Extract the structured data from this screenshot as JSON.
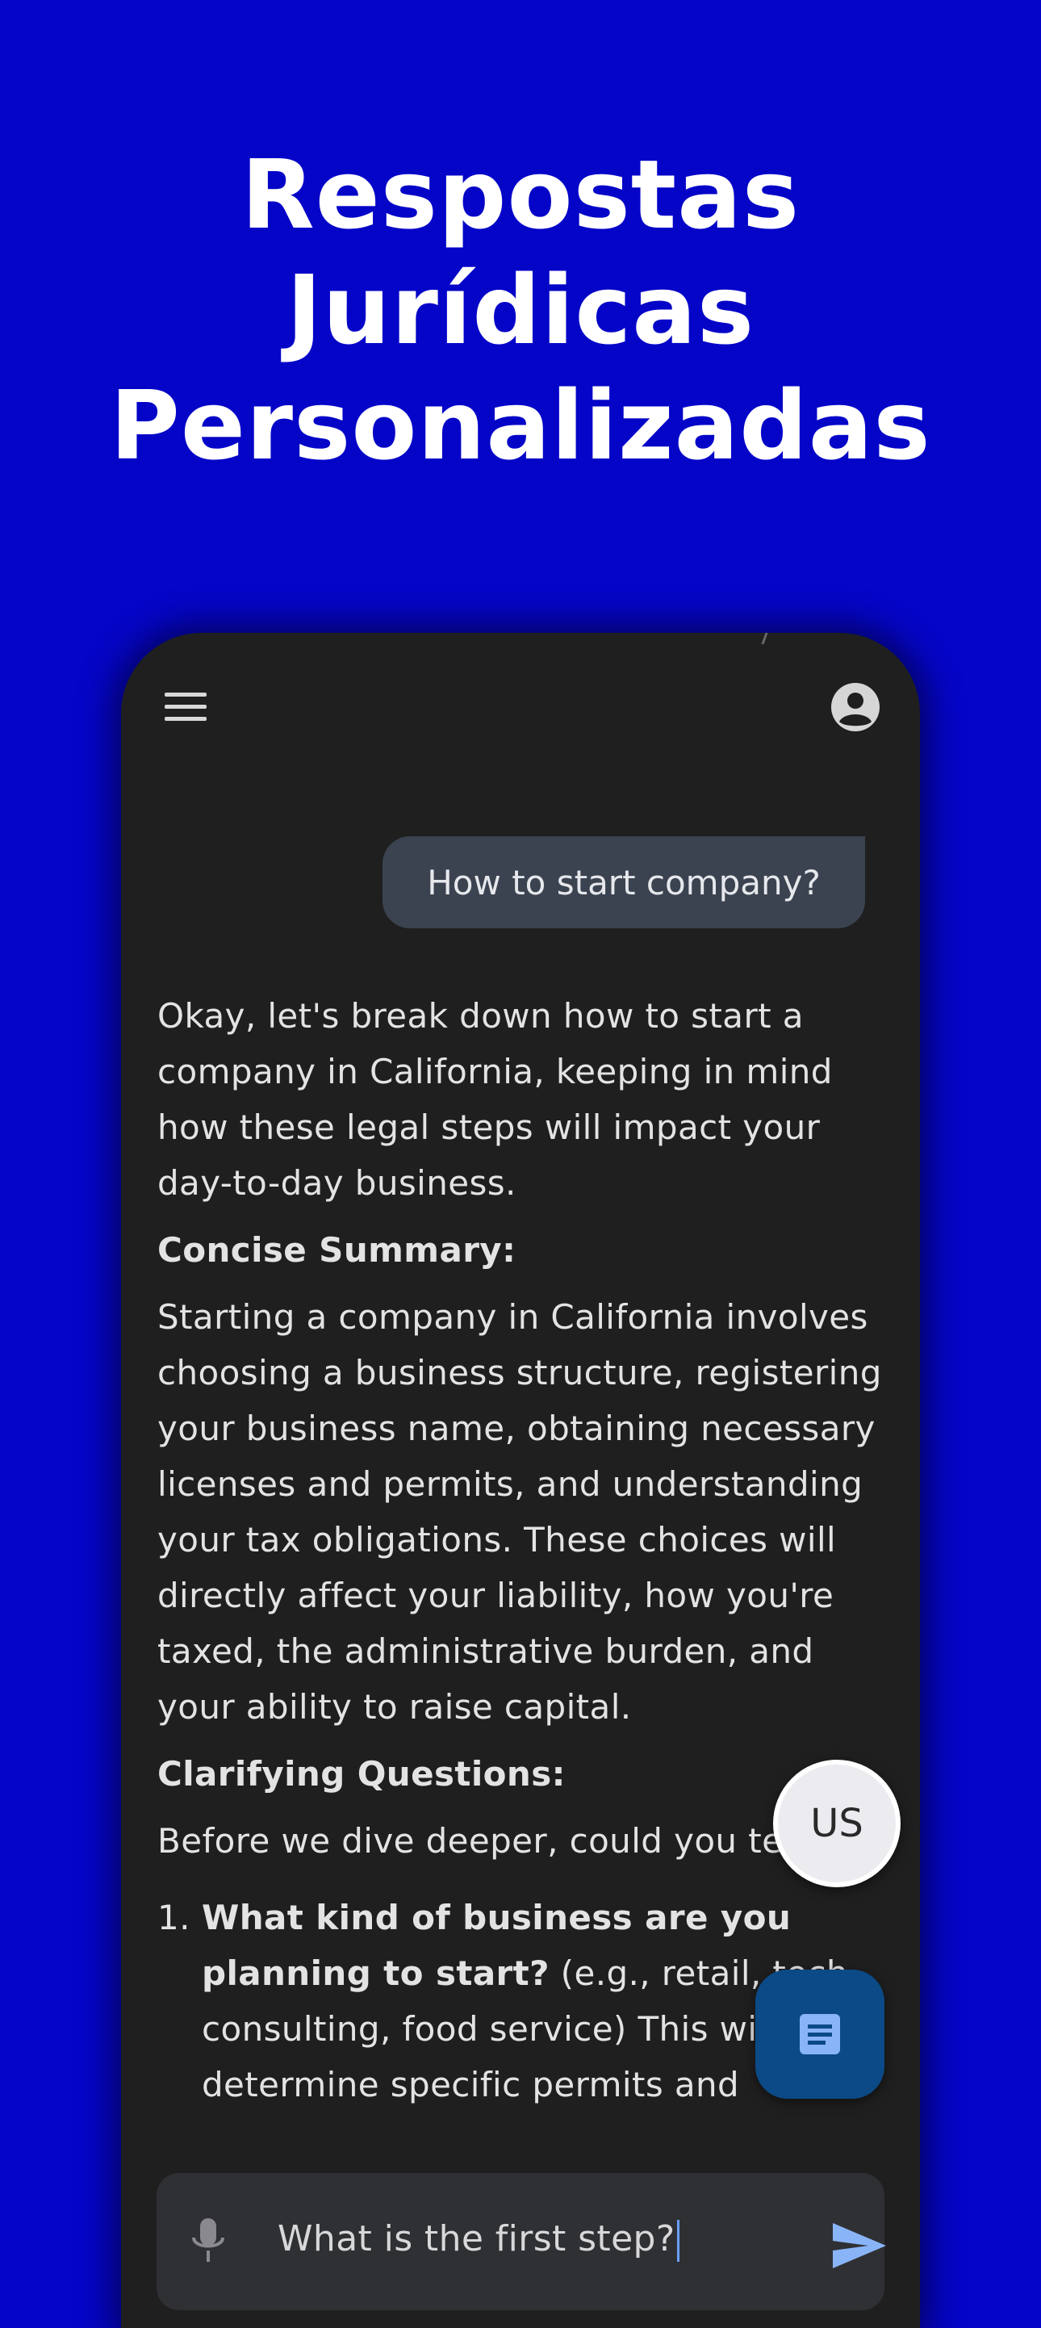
{
  "headline": {
    "lines": [
      "Respostas",
      "Jurídicas",
      "Personalizadas"
    ]
  },
  "app": {
    "menu_icon": "hamburger-menu-icon",
    "account_icon": "account-circle-icon",
    "user_message": "How to start company?",
    "answer": {
      "intro": "Okay, let's break down how to start a company in California, keeping in mind how these legal steps will impact your day-to-day business.",
      "summary_heading": "Concise Summary:",
      "summary_body": "Starting a company in California involves choosing a business structure, registering your business name, obtaining necessary licenses and permits, and understanding your tax obligations. These choices will directly affect your liability, how you're taxed, the administrative burden, and your ability to raise capital.",
      "questions_heading": "Clarifying Questions:",
      "questions_intro": "Before we dive deeper, could you tell me:",
      "questions": [
        {
          "number": "1.",
          "bold": "What kind of business are you planning to start?",
          "rest": " (e.g., retail, tech, consulting, food service) This will help determine specific permits and"
        }
      ]
    },
    "language_fab_label": "US",
    "document_fab_icon": "document-icon",
    "input": {
      "value": "What is the first step?",
      "mic_icon": "microphone-icon",
      "send_icon": "send-icon"
    }
  },
  "colors": {
    "background": "#0505c8",
    "phone_bg": "#1f1f20",
    "user_bubble": "#3b4350",
    "doc_fab": "#0b4a86",
    "accent": "#8ab4f8"
  }
}
